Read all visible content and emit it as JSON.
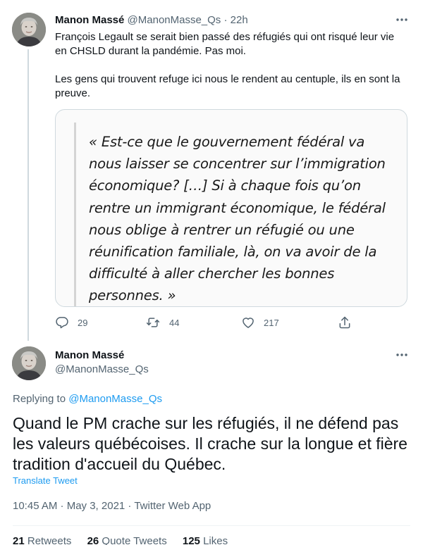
{
  "parent_tweet": {
    "author_name": "Manon Massé",
    "author_handle": "@ManonMasse_Qs",
    "separator": "·",
    "time": "22h",
    "paragraphs": [
      "François Legault se serait bien passé des réfugiés qui ont risqué leur vie en CHSLD durant la pandémie. Pas moi.",
      "Les gens qui trouvent refuge ici nous le rendent au centuple, ils en sont la preuve."
    ],
    "quote_image_text": "« Est-ce que le gouvernement fédéral va nous laisser se concentrer sur l’immigration économique? […] Si à chaque fois qu’on rentre un immigrant économique, le fédéral nous oblige à rentrer un réfugié ou une réunification familiale, là, on va avoir de la difficulté à aller chercher les bonnes personnes. »",
    "actions": {
      "reply_count": "29",
      "retweet_count": "44",
      "like_count": "217"
    }
  },
  "focused_tweet": {
    "author_name": "Manon Massé",
    "author_handle": "@ManonMasse_Qs",
    "replying_label": "Replying to",
    "replying_to": "@ManonMasse_Qs",
    "text": "Quand le PM crache sur les réfugiés, il ne défend pas les valeurs québécoises. Il crache sur la longue et fière tradition d'accueil du Québec.",
    "translate_label": "Translate Tweet",
    "timestamp": "10:45 AM · May 3, 2021 · Twitter Web App",
    "stats": {
      "retweets_num": "21",
      "retweets_label": "Retweets",
      "quotes_num": "26",
      "quotes_label": "Quote Tweets",
      "likes_num": "125",
      "likes_label": "Likes"
    }
  },
  "colors": {
    "link": "#1d9bf0",
    "secondary_text": "#536471",
    "primary_text": "#0f1419",
    "border": "#cfd9de"
  },
  "icons": {
    "more": "more-horizontal-icon",
    "reply": "reply-bubble-icon",
    "retweet": "retweet-icon",
    "like": "heart-icon",
    "share": "share-upload-icon"
  }
}
